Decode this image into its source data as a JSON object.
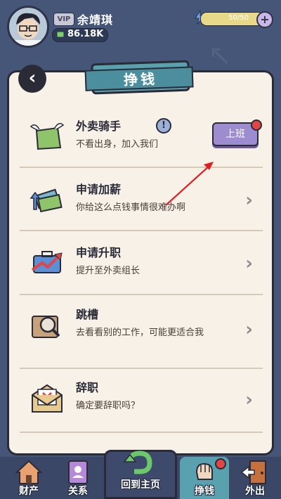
{
  "header": {
    "vip_label": "VIP",
    "player_name": "余靖琪",
    "money": "86.18K",
    "energy_text": "50/50",
    "energy_fraction": 1.0,
    "plus_label": "+"
  },
  "page": {
    "title": "挣钱",
    "back_glyph": "‹"
  },
  "jobs": [
    {
      "title": "外卖骑手",
      "desc": "不看出身，加入我们",
      "icon": "food-bag-icon",
      "button_label": "上班",
      "info_glyph": "!"
    },
    {
      "title": "申请加薪",
      "desc": "你给这么点钱事情很难办啊",
      "icon": "money-stack-icon"
    },
    {
      "title": "申请升职",
      "desc": "提升至外卖组长",
      "icon": "briefcase-growth-icon"
    },
    {
      "title": "跳槽",
      "desc": "去看看别的工作，可能更适合我",
      "icon": "magnifier-icon"
    },
    {
      "title": "辞职",
      "desc": "确定要辞职吗？",
      "icon": "resignation-letter-icon"
    }
  ],
  "chevron_glyph": "›",
  "nav": {
    "items": [
      {
        "label": "财产",
        "icon": "house-icon"
      },
      {
        "label": "关系",
        "icon": "relation-book-icon"
      },
      {
        "label": "回到主页",
        "icon": "return-arrow-icon"
      },
      {
        "label": "挣钱",
        "icon": "fist-icon",
        "active": true
      },
      {
        "label": "外出",
        "icon": "door-exit-icon"
      }
    ]
  },
  "colors": {
    "background": "#465678",
    "panel": "#f7f1e8",
    "accent": "#5aa1b0",
    "button": "#9d8ccf",
    "notify": "#e04646",
    "annotation_arrow": "#e02020"
  }
}
